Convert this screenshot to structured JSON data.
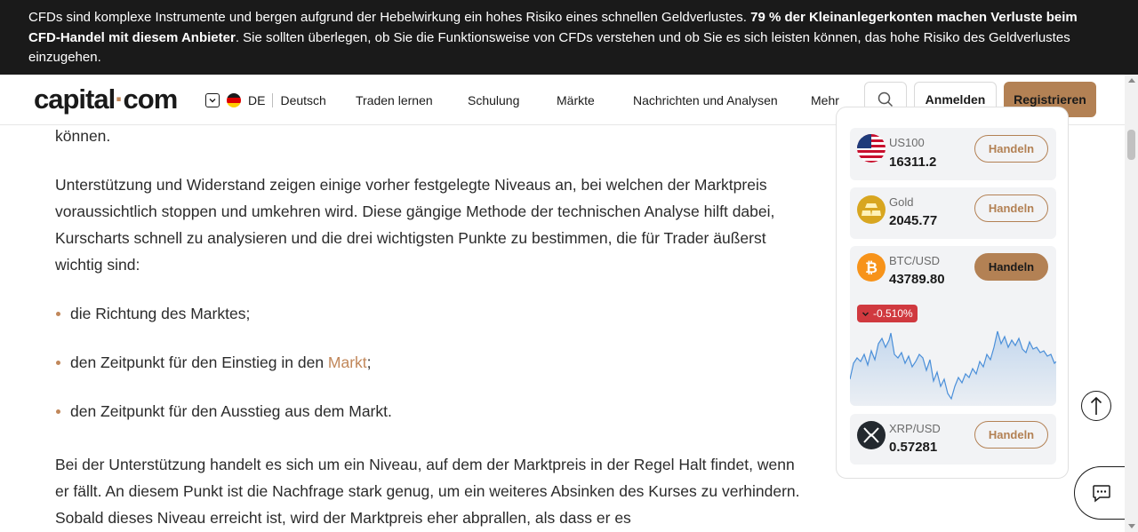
{
  "risk_banner": {
    "text_a": "CFDs sind komplexe Instrumente und bergen aufgrund der Hebelwirkung ein hohes Risiko eines schnellen Geldverlustes. ",
    "text_bold": "79 % der Kleinanlegerkonten machen Verluste beim CFD-Handel mit diesem Anbieter",
    "text_b": ". Sie sollten überlegen, ob Sie die Funktionsweise von CFDs verstehen und ob Sie es sich leisten können, das hohe Risiko des Geldverlustes einzugehen."
  },
  "header": {
    "logo_left": "capital",
    "logo_dot": "·",
    "logo_right": "com",
    "lang_code": "DE",
    "lang_name": "Deutsch",
    "nav": [
      "Traden lernen",
      "Schulung",
      "Märkte",
      "Nachrichten und Analysen",
      "Mehr"
    ],
    "login_label": "Anmelden",
    "register_label": "Registrieren"
  },
  "article": {
    "intro_tail": "können.",
    "p1": "Unterstützung und Widerstand zeigen einige vorher festgelegte Niveaus an, bei welchen der Marktpreis voraussichtlich stoppen und umkehren wird. Diese gängige Methode der technischen Analyse hilft dabei, Kurscharts schnell zu analysieren und die drei wichtigsten Punkte zu bestimmen, die für Trader äußerst wichtig sind:",
    "bullet1": "die Richtung des Marktes;",
    "bullet2_pre": "den Zeitpunkt für den Einstieg in den ",
    "bullet2_link": "Markt",
    "bullet2_post": ";",
    "bullet3": "den Zeitpunkt für den Ausstieg aus dem Markt.",
    "p2": "Bei der Unterstützung handelt es sich um ein Niveau, auf dem der Marktpreis in der Regel Halt findet, wenn er fällt. An diesem Punkt ist die Nachfrage stark genug, um ein weiteres Absinken des Kurses zu verhindern. Sobald dieses Niveau erreicht ist, wird der Marktpreis eher abprallen, als dass er es"
  },
  "markets": {
    "trade_label": "Handeln",
    "items": [
      {
        "name": "US100",
        "price": "16311.2",
        "icon": "us-flag-icon"
      },
      {
        "name": "Gold",
        "price": "2045.77",
        "icon": "gold-icon"
      },
      {
        "name": "BTC/USD",
        "price": "43789.80",
        "icon": "bitcoin-icon",
        "change": "-0.510%"
      },
      {
        "name": "XRP/USD",
        "price": "0.57281",
        "icon": "xrp-icon"
      }
    ],
    "colors": {
      "accent": "#b38154",
      "negative": "#d0393f",
      "sparkline": "#4a8fd9"
    }
  }
}
